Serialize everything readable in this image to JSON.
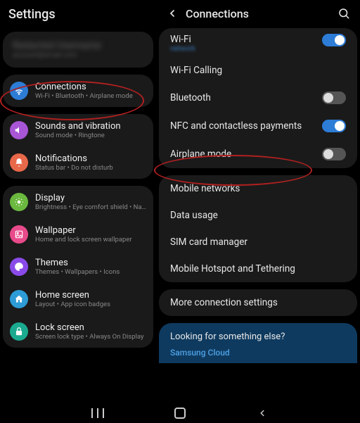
{
  "left": {
    "header_title": "Settings",
    "profile": {
      "name": "Redacted Username",
      "email": "account@email.com"
    },
    "group1": {
      "connections": {
        "title": "Connections",
        "sub": "Wi-Fi • Bluetooth • Airplane mode"
      }
    },
    "group2": {
      "sounds": {
        "title": "Sounds and vibration",
        "sub": "Sound mode • Ringtone"
      },
      "notifications": {
        "title": "Notifications",
        "sub": "Status bar • Do not disturb"
      }
    },
    "group3": {
      "display": {
        "title": "Display",
        "sub": "Brightness • Eye comfort shield • Navi"
      },
      "wallpaper": {
        "title": "Wallpaper",
        "sub": "Home and lock screen wallpaper"
      },
      "themes": {
        "title": "Themes",
        "sub": "Themes • Wallpapers • Icons"
      },
      "homescreen": {
        "title": "Home screen",
        "sub": "Layout • App icon badges"
      },
      "lockscreen": {
        "title": "Lock screen",
        "sub": "Screen lock type • Always On Display"
      }
    }
  },
  "right": {
    "header_title": "Connections",
    "wifi": {
      "title": "Wi-Fi",
      "sub": "network"
    },
    "items1": {
      "wifi_calling": "Wi-Fi Calling",
      "bluetooth": "Bluetooth",
      "nfc": "NFC and contactless payments",
      "airplane": "Airplane mode"
    },
    "items2": {
      "mobile_networks": "Mobile networks",
      "data_usage": "Data usage",
      "sim": "SIM card manager",
      "hotspot": "Mobile Hotspot and Tethering"
    },
    "more": "More connection settings",
    "suggest": {
      "title": "Looking for something else?",
      "link": "Samsung Cloud"
    }
  },
  "icon_colors": {
    "connections": "#2d7cd6",
    "sounds": "#a855d6",
    "notifications": "#e8684a",
    "display": "#6bb83f",
    "wallpaper": "#e84a8a",
    "themes": "#8a4ae8",
    "homescreen": "#2d9cd6",
    "lockscreen": "#1aaa8f"
  }
}
